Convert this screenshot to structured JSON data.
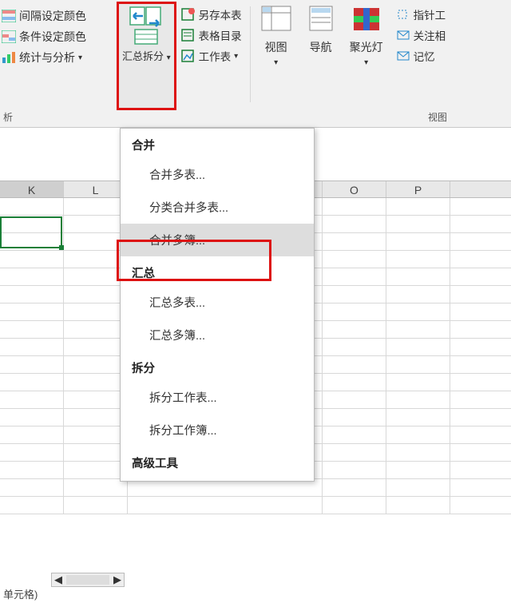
{
  "ribbon": {
    "left_items": [
      "间隔设定颜色",
      "条件设定颜色",
      "统计与分析"
    ],
    "huizong_label": "汇总拆分",
    "mid_items": [
      "另存本表",
      "表格目录",
      "工作表"
    ],
    "views": [
      "视图",
      "导航",
      "聚光灯"
    ],
    "right_items": [
      "指针工",
      "关注相",
      "记忆"
    ],
    "group_x": "析",
    "group_v": "视图"
  },
  "menu": {
    "h1": "合并",
    "i1": "合并多表...",
    "i2": "分类合并多表...",
    "i3": "合并多簿...",
    "h2": "汇总",
    "i4": "汇总多表...",
    "i5": "汇总多簿...",
    "h3": "拆分",
    "i6": "拆分工作表...",
    "i7": "拆分工作簿...",
    "h4": "高级工具"
  },
  "columns": [
    "K",
    "L",
    "",
    "",
    "O",
    "P"
  ],
  "status": "单元格)",
  "glyph": {
    "dropdown": "▾",
    "left": "◀",
    "right": "▶"
  }
}
